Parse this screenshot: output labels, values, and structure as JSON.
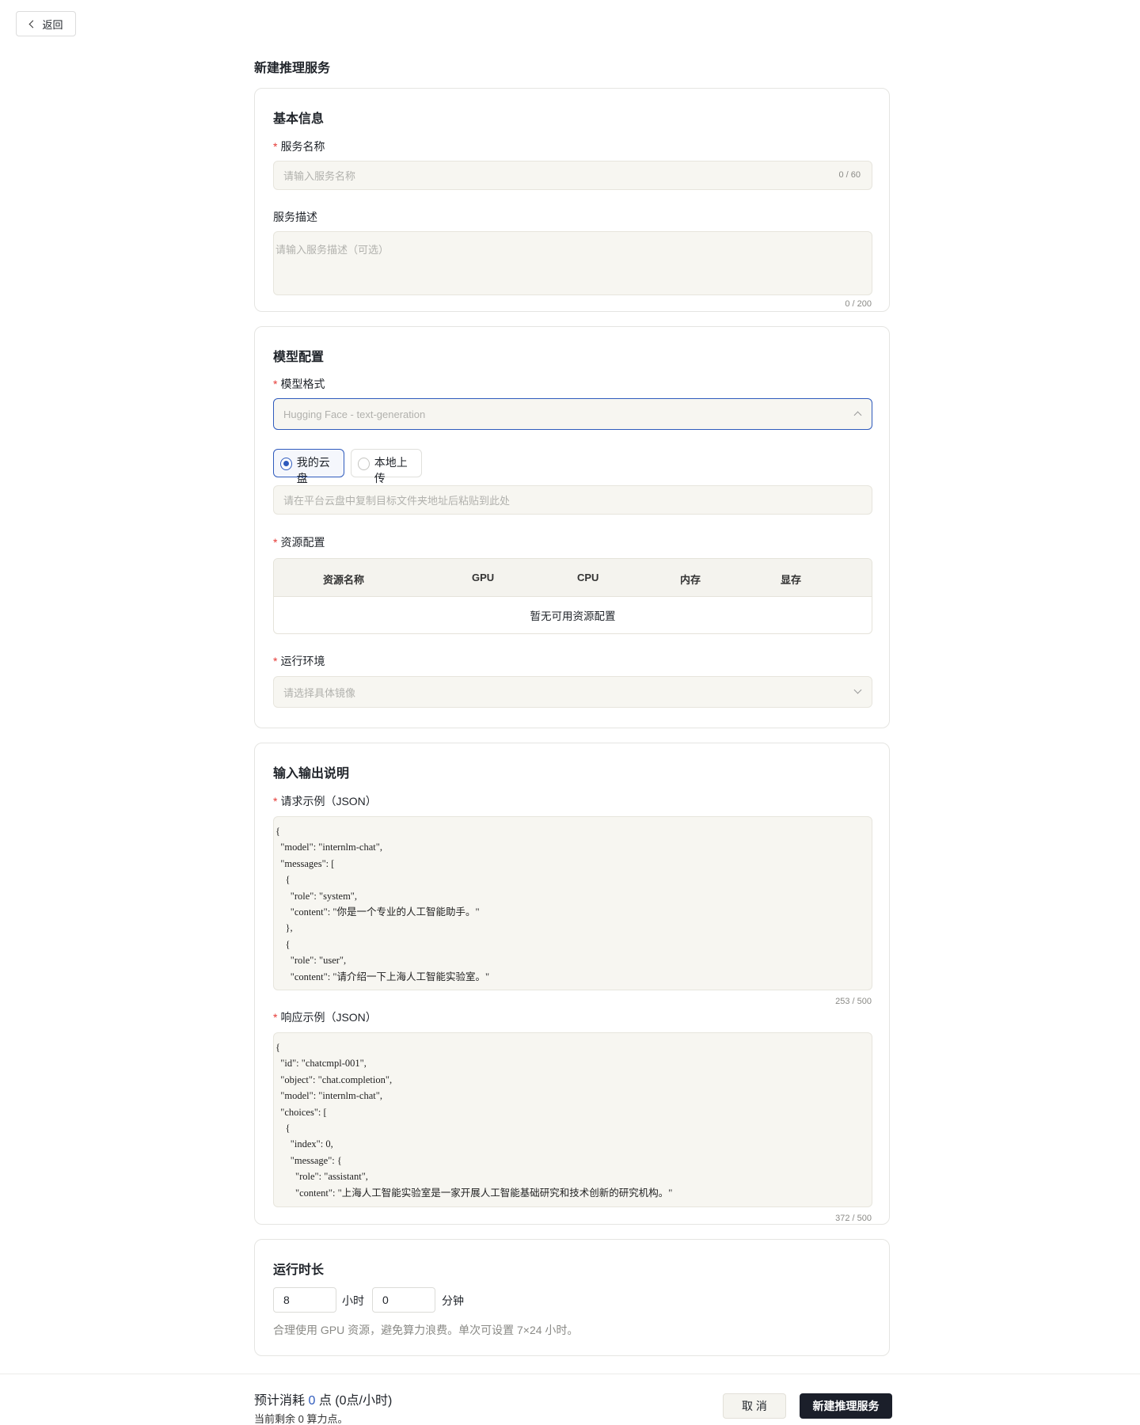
{
  "back_label": "返回",
  "page_title": "新建推理服务",
  "basic": {
    "title": "基本信息",
    "name_label": "服务名称",
    "name_placeholder": "请输入服务名称",
    "name_counter": "0 / 60",
    "desc_label": "服务描述",
    "desc_placeholder": "请输入服务描述（可选）",
    "desc_counter": "0 / 200"
  },
  "model": {
    "title": "模型配置",
    "format_label": "模型格式",
    "format_value": "Hugging Face - text-generation",
    "source_options": [
      "我的云盘",
      "本地上传"
    ],
    "selected_source": "我的云盘",
    "path_placeholder": "请在平台云盘中复制目标文件夹地址后粘贴到此处",
    "resource_label": "资源配置",
    "columns": [
      "资源名称",
      "GPU",
      "CPU",
      "内存",
      "显存"
    ],
    "empty_text": "暂无可用资源配置",
    "env_label": "运行环境",
    "env_placeholder": "请选择具体镜像"
  },
  "io": {
    "title": "输入输出说明",
    "request_label": "请求示例（JSON）",
    "request_example": "{\n  \"model\": \"internlm-chat\",\n  \"messages\": [\n    {\n      \"role\": \"system\",\n      \"content\": \"你是一个专业的人工智能助手。\"\n    },\n    {\n      \"role\": \"user\",\n      \"content\": \"请介绍一下上海人工智能实验室。\"",
    "request_counter": "253 / 500",
    "response_label": "响应示例（JSON）",
    "response_example": "{\n  \"id\": \"chatcmpl-001\",\n  \"object\": \"chat.completion\",\n  \"model\": \"internlm-chat\",\n  \"choices\": [\n    {\n      \"index\": 0,\n      \"message\": {\n        \"role\": \"assistant\",\n        \"content\": \"上海人工智能实验室是一家开展人工智能基础研究和技术创新的研究机构。\"",
    "response_counter": "372 / 500"
  },
  "runtime": {
    "title": "运行时长",
    "hours": "8",
    "hours_unit": "小时",
    "minutes": "0",
    "minutes_unit": "分钟",
    "hint": "合理使用 GPU 资源，避免算力浪费。单次可设置 7×24 小时。"
  },
  "footer": {
    "cost_prefix": "预计消耗",
    "cost_value": "0",
    "cost_suffix": "点 (0点/小时)",
    "remain": "当前剩余 0 算力点。",
    "cancel_label": "取 消",
    "submit_label": "新建推理服务"
  },
  "colors": {
    "accent": "#2f5bbd",
    "primary_button": "#1b1f2a",
    "required": "#e53935"
  }
}
